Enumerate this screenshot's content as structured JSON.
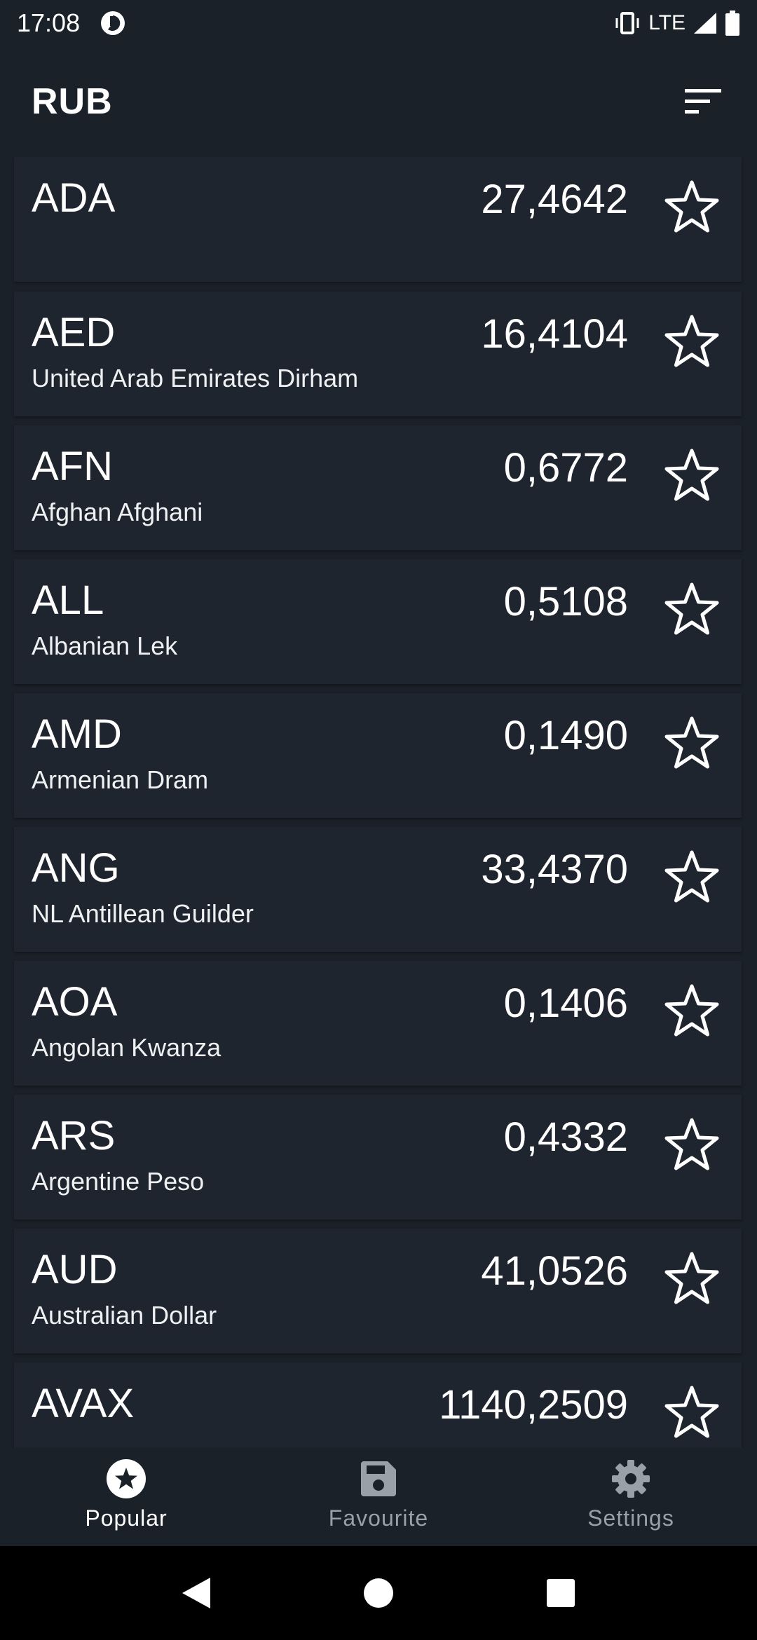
{
  "status_bar": {
    "time": "17:08",
    "network": "LTE",
    "icons": [
      "app-indicator-icon",
      "vibrate-icon",
      "signal-icon",
      "battery-icon"
    ]
  },
  "app_bar": {
    "title": "RUB",
    "sort_icon": "sort-icon"
  },
  "currencies": [
    {
      "code": "ADA",
      "name": "",
      "rate": "27,4642"
    },
    {
      "code": "AED",
      "name": "United Arab Emirates Dirham",
      "rate": "16,4104"
    },
    {
      "code": "AFN",
      "name": "Afghan Afghani",
      "rate": "0,6772"
    },
    {
      "code": "ALL",
      "name": "Albanian Lek",
      "rate": "0,5108"
    },
    {
      "code": "AMD",
      "name": "Armenian Dram",
      "rate": "0,1490"
    },
    {
      "code": "ANG",
      "name": "NL Antillean Guilder",
      "rate": "33,4370"
    },
    {
      "code": "AOA",
      "name": "Angolan Kwanza",
      "rate": "0,1406"
    },
    {
      "code": "ARS",
      "name": "Argentine Peso",
      "rate": "0,4332"
    },
    {
      "code": "AUD",
      "name": "Australian Dollar",
      "rate": "41,0526"
    },
    {
      "code": "AVAX",
      "name": "",
      "rate": "1140,2509"
    }
  ],
  "bottom_nav": {
    "items": [
      {
        "label": "Popular",
        "icon": "star-circle-icon",
        "active": true
      },
      {
        "label": "Favourite",
        "icon": "save-icon",
        "active": false
      },
      {
        "label": "Settings",
        "icon": "gear-icon",
        "active": false
      }
    ]
  },
  "colors": {
    "background": "#1b2129",
    "card": "#1f252e",
    "text": "#ffffff",
    "inactive": "#9aa0a8"
  }
}
